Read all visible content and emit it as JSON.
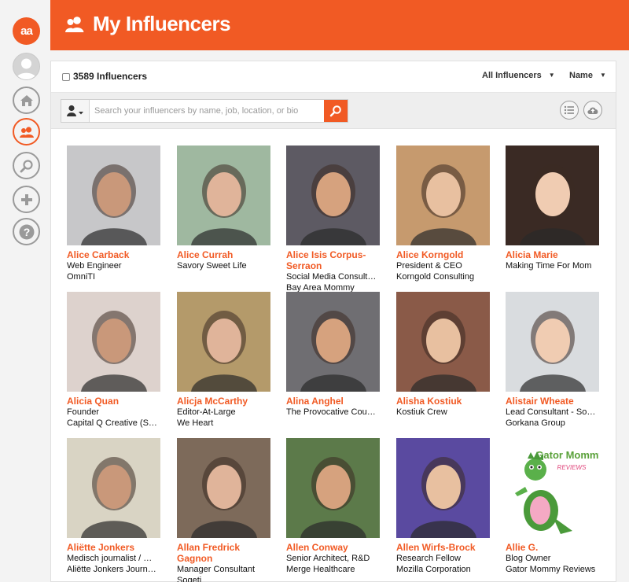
{
  "app": {
    "logo_text": "aa",
    "page_title": "My Influencers",
    "accent_color": "#f15a24"
  },
  "sidebar": {
    "items": [
      {
        "icon": "logo-icon"
      },
      {
        "icon": "avatar"
      },
      {
        "icon": "home-icon"
      },
      {
        "icon": "people-icon",
        "active": true
      },
      {
        "icon": "search-icon"
      },
      {
        "icon": "plus-icon"
      },
      {
        "icon": "help-icon"
      }
    ]
  },
  "list_header": {
    "count_label": "3589 Influencers",
    "filter_label": "All Influencers",
    "sort_label": "Name"
  },
  "search": {
    "placeholder": "Search your influencers by name, job, location, or bio",
    "value": ""
  },
  "influencers": [
    {
      "name": "Alice Carback",
      "lines": [
        "Web Engineer",
        "OmniTI"
      ],
      "bg": "#c7c7c9"
    },
    {
      "name": "Alice Currah",
      "lines": [
        "Savory Sweet Life"
      ],
      "bg": "#9fb8a0"
    },
    {
      "name": "Alice Isis Corpus-Serraon",
      "lines": [
        "Social Media Consult…",
        "Bay Area Mommy"
      ],
      "bg": "#5d5a63"
    },
    {
      "name": "Alice Korngold",
      "lines": [
        "President & CEO",
        "Korngold Consulting"
      ],
      "bg": "#c69a6e"
    },
    {
      "name": "Alicia Marie",
      "lines": [
        "Making Time For Mom"
      ],
      "bg": "#3a2a24"
    },
    {
      "name": "Alicia Quan",
      "lines": [
        "Founder",
        "Capital Q Creative (S…"
      ],
      "bg": "#ddd2cd"
    },
    {
      "name": "Alicja McCarthy",
      "lines": [
        "Editor-At-Large",
        "We Heart"
      ],
      "bg": "#b49a6a"
    },
    {
      "name": "Alina Anghel",
      "lines": [
        "The Provocative Cou…"
      ],
      "bg": "#6f6e72"
    },
    {
      "name": "Alisha Kostiuk",
      "lines": [
        "Kostiuk Crew"
      ],
      "bg": "#8a5a48"
    },
    {
      "name": "Alistair Wheate",
      "lines": [
        "Lead Consultant - So…",
        "Gorkana Group"
      ],
      "bg": "#d9dcdf"
    },
    {
      "name": "Aliëtte Jonkers",
      "lines": [
        "Medisch journalist / …",
        "Aliëtte Jonkers Journ…"
      ],
      "bg": "#d9d4c4"
    },
    {
      "name": "Allan Fredrick Gagnon",
      "lines": [
        "Manager Consultant",
        "Sogeti"
      ],
      "bg": "#7d6a5a"
    },
    {
      "name": "Allen Conway",
      "lines": [
        "Senior Architect, R&D",
        "Merge Healthcare"
      ],
      "bg": "#5c7a4a"
    },
    {
      "name": "Allen Wirfs-Brock",
      "lines": [
        "Research Fellow",
        "Mozilla Corporation"
      ],
      "bg": "#5a4aa0"
    },
    {
      "name": "Allie G.",
      "lines": [
        "Blog Owner",
        "Gator Mommy Reviews"
      ],
      "bg": "#ffffff",
      "logo_text": "Gator Mommy",
      "logo_sub": "REVIEWS"
    }
  ]
}
